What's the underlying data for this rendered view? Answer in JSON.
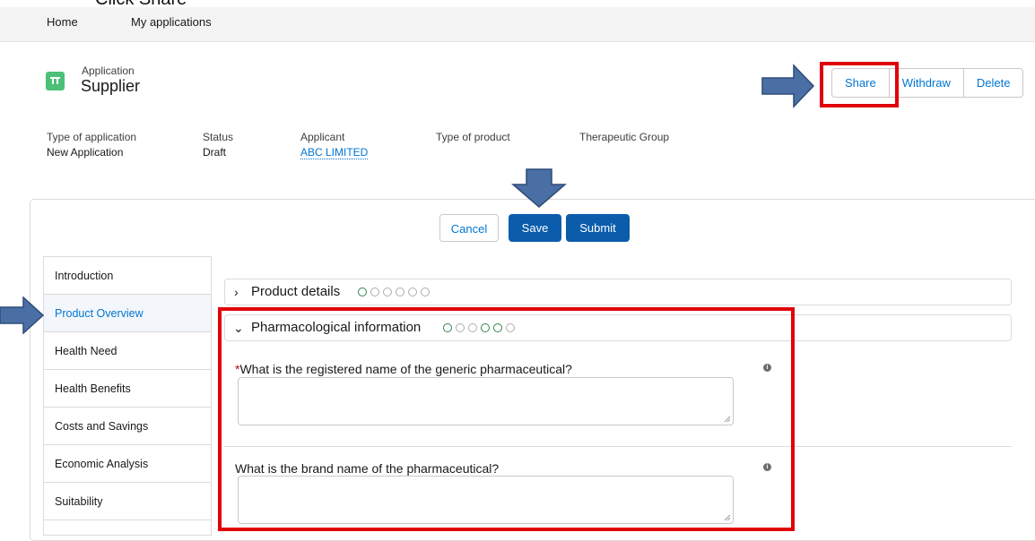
{
  "instruction": "Click Share",
  "nav": {
    "items": [
      {
        "label": "Home"
      },
      {
        "label": "My applications"
      }
    ]
  },
  "header": {
    "subtitle": "Application",
    "title": "Supplier",
    "actions": {
      "share": "Share",
      "withdraw": "Withdraw",
      "delete": "Delete"
    }
  },
  "fields": {
    "type_of_application": {
      "label": "Type of application",
      "value": "New Application"
    },
    "status": {
      "label": "Status",
      "value": "Draft"
    },
    "applicant": {
      "label": "Applicant",
      "value": "ABC LIMITED"
    },
    "type_of_product": {
      "label": "Type of product",
      "value": ""
    },
    "therapeutic_group": {
      "label": "Therapeutic Group",
      "value": ""
    }
  },
  "form_actions": {
    "cancel": "Cancel",
    "save": "Save",
    "submit": "Submit"
  },
  "sidebar": {
    "items": [
      {
        "label": "Introduction"
      },
      {
        "label": "Product Overview"
      },
      {
        "label": "Health Need"
      },
      {
        "label": "Health Benefits"
      },
      {
        "label": "Costs and Savings"
      },
      {
        "label": "Economic Analysis"
      },
      {
        "label": "Suitability"
      }
    ],
    "active": "Product Overview"
  },
  "sections": {
    "product_details": {
      "title": "Product details",
      "expanded": false
    },
    "pharmacological": {
      "title": "Pharmacological information",
      "expanded": true,
      "questions": [
        {
          "label": "What is the registered name of the generic pharmaceutical?",
          "required": true,
          "value": ""
        },
        {
          "label": "What is the brand name of the pharmaceutical?",
          "required": false,
          "value": ""
        }
      ]
    }
  },
  "colors": {
    "brand_blue": "#0b5cab",
    "link_blue": "#0176d3",
    "highlight_red": "#e10008",
    "annotation_arrow": "#4a6fa5",
    "app_icon_green": "#4bc076"
  },
  "icons": {
    "app": "app-icon",
    "expand": "chevron-right-icon",
    "collapse": "chevron-down-icon",
    "info": "info-icon",
    "arrow": "annotation-arrow-icon"
  }
}
